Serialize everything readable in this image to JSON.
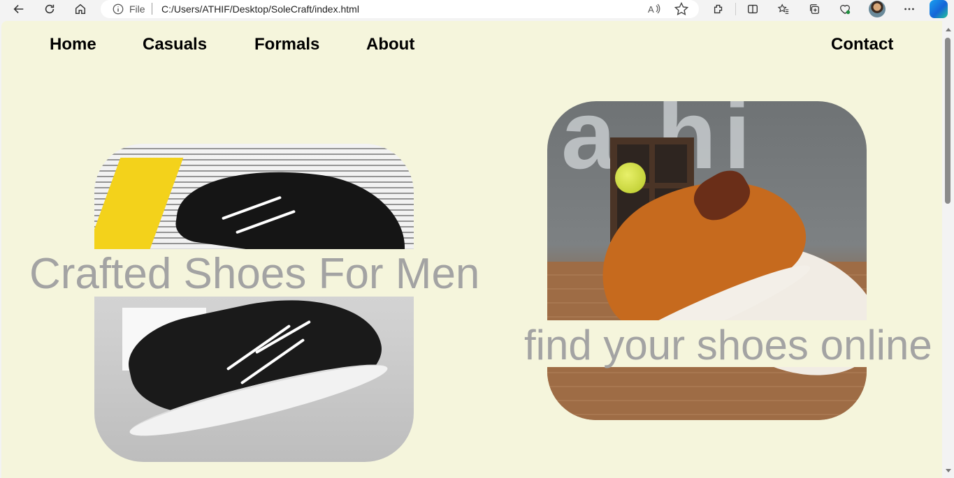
{
  "browser": {
    "file_label": "File",
    "url": "C:/Users/ATHIF/Desktop/SoleCraft/index.html",
    "icons": [
      "back-icon",
      "refresh-icon",
      "home-icon",
      "info-icon",
      "read-aloud-icon",
      "favorite-star-icon",
      "extensions-icon",
      "split-screen-icon",
      "favorites-icon",
      "collections-icon",
      "browser-essentials-icon",
      "profile-avatar",
      "more-icon",
      "copilot-icon"
    ]
  },
  "nav": {
    "home": "Home",
    "casuals": "Casuals",
    "formals": "Formals",
    "about": "About",
    "contact": "Contact"
  },
  "hero": {
    "left_text": "Crafted Shoes For Men",
    "right_text": "find your shoes online"
  },
  "colors": {
    "page_background": "#f5f5dc",
    "overlay_text": "#a3a3a3",
    "nav_text": "#000000"
  }
}
